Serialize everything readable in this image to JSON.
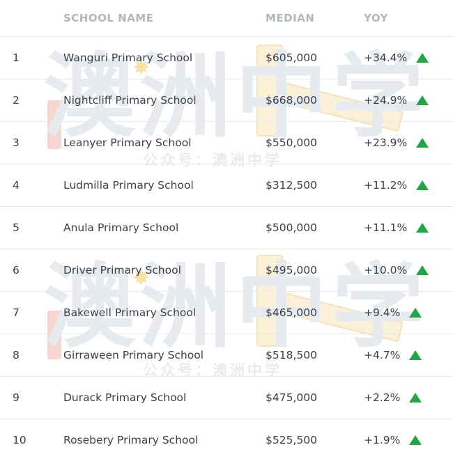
{
  "table": {
    "headers": {
      "rank": "",
      "school_name": "SCHOOL NAME",
      "median": "MEDIAN",
      "yoy": "YOY"
    },
    "rows": [
      {
        "rank": "1",
        "school": "Wanguri Primary School",
        "median": "$605,000",
        "yoy": "+34.4%",
        "trend": "up"
      },
      {
        "rank": "2",
        "school": "Nightcliff Primary School",
        "median": "$668,000",
        "yoy": "+24.9%",
        "trend": "up"
      },
      {
        "rank": "3",
        "school": "Leanyer Primary School",
        "median": "$550,000",
        "yoy": "+23.9%",
        "trend": "up"
      },
      {
        "rank": "4",
        "school": "Ludmilla Primary School",
        "median": "$312,500",
        "yoy": "+11.2%",
        "trend": "up"
      },
      {
        "rank": "5",
        "school": "Anula Primary School",
        "median": "$500,000",
        "yoy": "+11.1%",
        "trend": "up"
      },
      {
        "rank": "6",
        "school": "Driver Primary School",
        "median": "$495,000",
        "yoy": "+10.0%",
        "trend": "up"
      },
      {
        "rank": "7",
        "school": "Bakewell Primary School",
        "median": "$465,000",
        "yoy": "+9.4%",
        "trend": "up"
      },
      {
        "rank": "8",
        "school": "Girraween Primary School",
        "median": "$518,500",
        "yoy": "+4.7%",
        "trend": "up"
      },
      {
        "rank": "9",
        "school": "Durack Primary School",
        "median": "$475,000",
        "yoy": "+2.2%",
        "trend": "up"
      },
      {
        "rank": "10",
        "school": "Rosebery Primary School",
        "median": "$525,500",
        "yoy": "+1.9%",
        "trend": "up"
      }
    ]
  },
  "watermark": {
    "big_text": "澳洲中学",
    "small_text": "公众号：澳洲中学"
  },
  "colors": {
    "trend_up": "#22a447",
    "header_text": "#b2b6bd",
    "divider": "#e6e8eb"
  },
  "icons": {
    "trend_up": "triangle-up-icon"
  }
}
